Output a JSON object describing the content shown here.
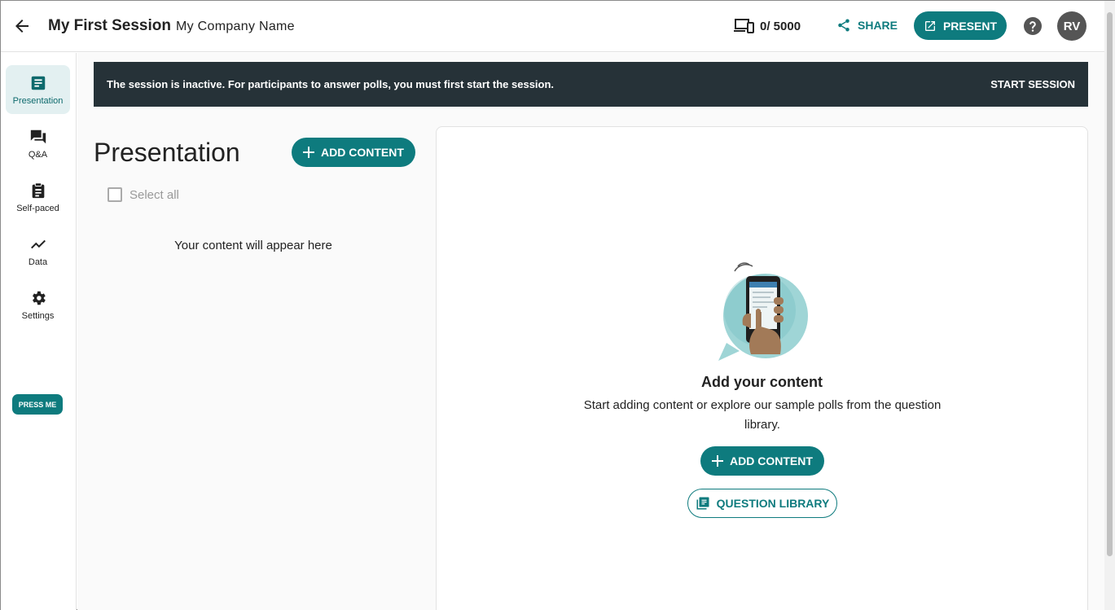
{
  "header": {
    "title": "My First Session",
    "company": "My Company Name",
    "participants": "0/ 5000",
    "share_label": "SHARE",
    "present_label": "PRESENT",
    "avatar_initials": "RV"
  },
  "sidebar": {
    "items": [
      {
        "label": "Presentation",
        "icon": "presentation-icon",
        "active": true
      },
      {
        "label": "Q&A",
        "icon": "forum-icon",
        "active": false
      },
      {
        "label": "Self-paced",
        "icon": "clipboard-icon",
        "active": false
      },
      {
        "label": "Data",
        "icon": "trend-line-icon",
        "active": false
      },
      {
        "label": "Settings",
        "icon": "gear-icon",
        "active": false
      }
    ],
    "press_me_label": "PRESS ME"
  },
  "banner": {
    "message": "The session is inactive. For participants to answer polls, you must first start the session.",
    "action_label": "START SESSION"
  },
  "content_list": {
    "title": "Presentation",
    "add_content_label": "ADD CONTENT",
    "select_all_label": "Select all",
    "empty_text": "Your content will appear here"
  },
  "empty_panel": {
    "title": "Add your content",
    "description": "Start adding content or explore our sample polls from the question library.",
    "add_content_label": "ADD CONTENT",
    "question_library_label": "QUESTION LIBRARY"
  },
  "colors": {
    "accent": "#0e7b7e",
    "banner_bg": "#263238",
    "active_nav_bg": "#e3f0f1"
  }
}
